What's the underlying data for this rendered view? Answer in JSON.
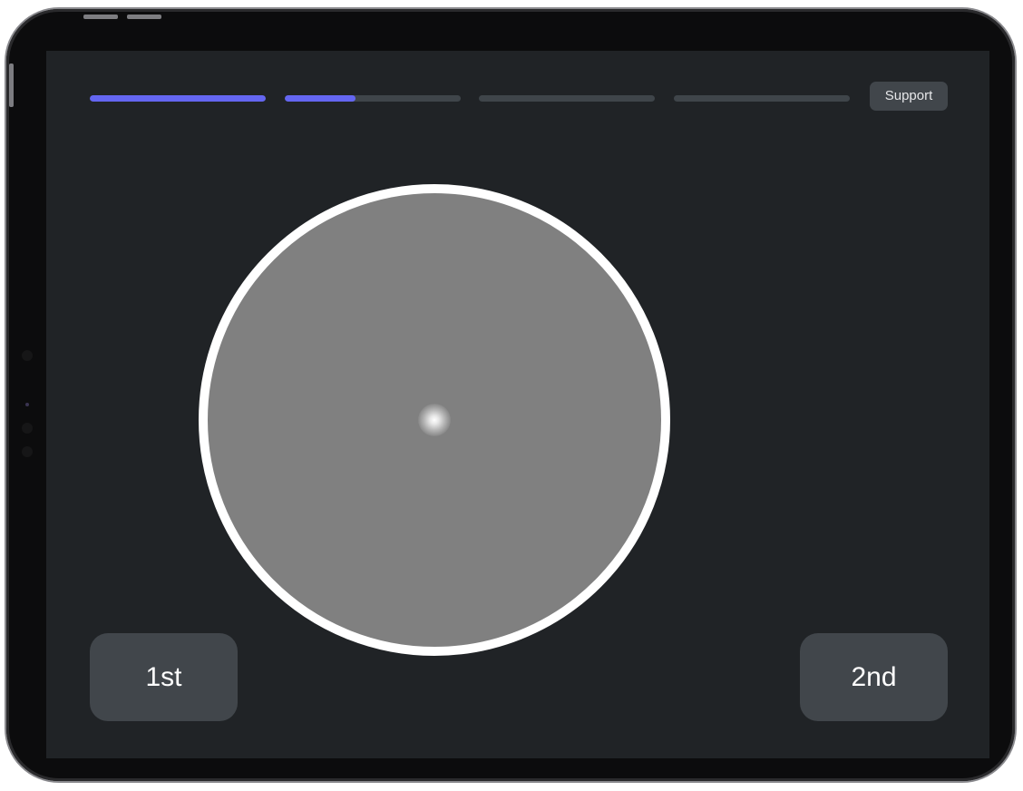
{
  "header": {
    "progress": [
      {
        "step": 1,
        "fraction": 1.0
      },
      {
        "step": 2,
        "fraction": 0.4
      },
      {
        "step": 3,
        "fraction": 0.0
      },
      {
        "step": 4,
        "fraction": 0.0
      }
    ],
    "support_label": "Support"
  },
  "choices": {
    "first_label": "1st",
    "second_label": "2nd"
  },
  "colors": {
    "screen_background": "#202326",
    "accent": "#6466f1",
    "track": "#3f454a",
    "button_background": "#41464b",
    "stimulus_fill": "#808080",
    "stimulus_border": "#ffffff"
  }
}
